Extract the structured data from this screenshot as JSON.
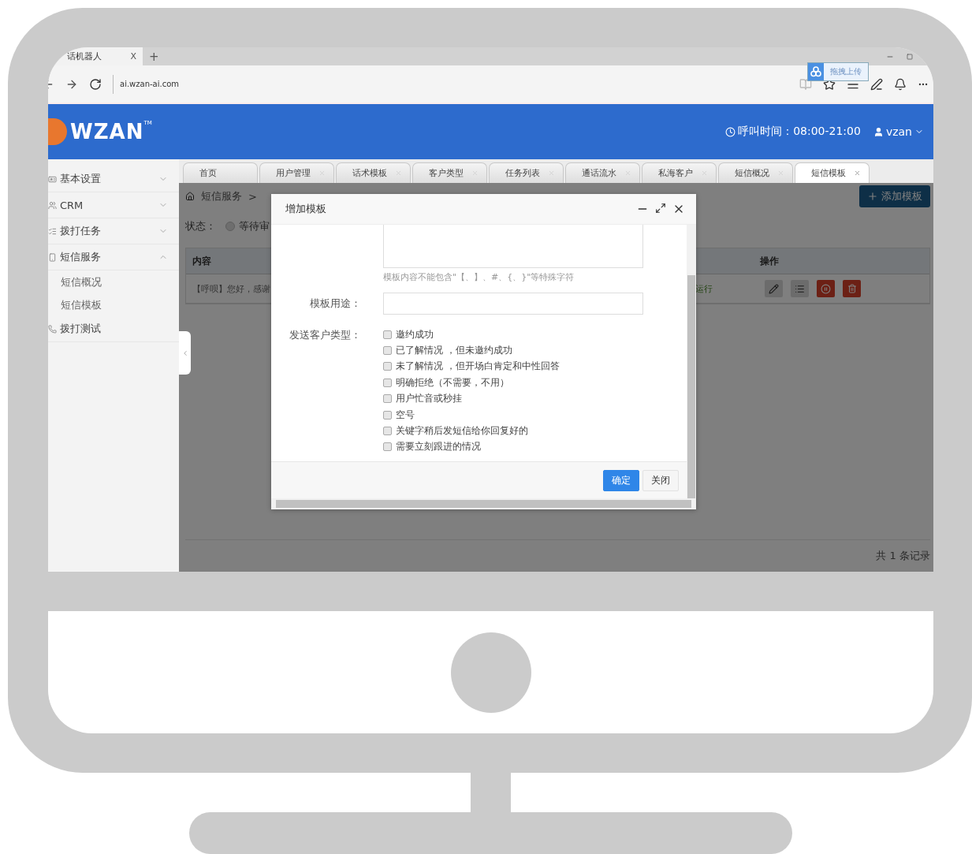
{
  "browser": {
    "tab_title": "话机器人",
    "tab_close": "X",
    "new_tab": "+",
    "url": "ai.wzan-ai.com",
    "upload_tip": "拖拽上传"
  },
  "header": {
    "logo": "WZAN",
    "logo_mark": "TM",
    "call_time": "呼叫时间：08:00-21:00",
    "user": "vzan"
  },
  "sidebar": {
    "items": [
      {
        "label": "基本设置",
        "expanded": false
      },
      {
        "label": "CRM",
        "expanded": false
      },
      {
        "label": "拨打任务",
        "expanded": false
      },
      {
        "label": "短信服务",
        "expanded": true,
        "children": [
          {
            "label": "短信概况"
          },
          {
            "label": "短信模板"
          }
        ]
      },
      {
        "label": "拨打测试"
      }
    ]
  },
  "tabs": [
    {
      "label": "首页",
      "selected": false,
      "closable": false
    },
    {
      "label": "用户管理",
      "selected": false,
      "closable": true
    },
    {
      "label": "话术模板",
      "selected": false,
      "closable": true
    },
    {
      "label": "客户类型",
      "selected": false,
      "closable": true
    },
    {
      "label": "任务列表",
      "selected": false,
      "closable": true
    },
    {
      "label": "通话流水",
      "selected": false,
      "closable": true
    },
    {
      "label": "私海客户",
      "selected": false,
      "closable": true
    },
    {
      "label": "短信概况",
      "selected": false,
      "closable": true
    },
    {
      "label": "短信模板",
      "selected": true,
      "closable": true
    }
  ],
  "breadcrumb": [
    "短信服务",
    ">"
  ],
  "add_button": "添加模板",
  "filter": {
    "label": "状态：",
    "option": "等待审",
    "selected": false
  },
  "table": {
    "columns": [
      {
        "label": "内容"
      },
      {
        "label": "操作"
      }
    ],
    "rows": [
      {
        "content": "【呼呗】您好，感谢",
        "status": "运行"
      }
    ]
  },
  "footer": "共 1 条记录",
  "modal": {
    "title": "增加模板",
    "hint": "模板内容不能包含\"【、】、#、{、}\"等特殊字符",
    "purpose_label": "模板用途：",
    "types_label": "发送客户类型：",
    "types": [
      {
        "label": "邀约成功",
        "checked": false
      },
      {
        "label": "已了解情况 ，但未邀约成功",
        "checked": false
      },
      {
        "label": "未了解情况 ，但开场白肯定和中性回答",
        "checked": false
      },
      {
        "label": "明确拒绝（不需要，不用）",
        "checked": false
      },
      {
        "label": "用户忙音或秒挂",
        "checked": false
      },
      {
        "label": "空号",
        "checked": false
      },
      {
        "label": "关键字稍后发短信给你回复好的",
        "checked": false
      },
      {
        "label": "需要立刻跟进的情况",
        "checked": false
      }
    ],
    "buttons": [
      {
        "label": "确定",
        "kind": "primary"
      },
      {
        "label": "关闭",
        "kind": "default"
      }
    ]
  }
}
